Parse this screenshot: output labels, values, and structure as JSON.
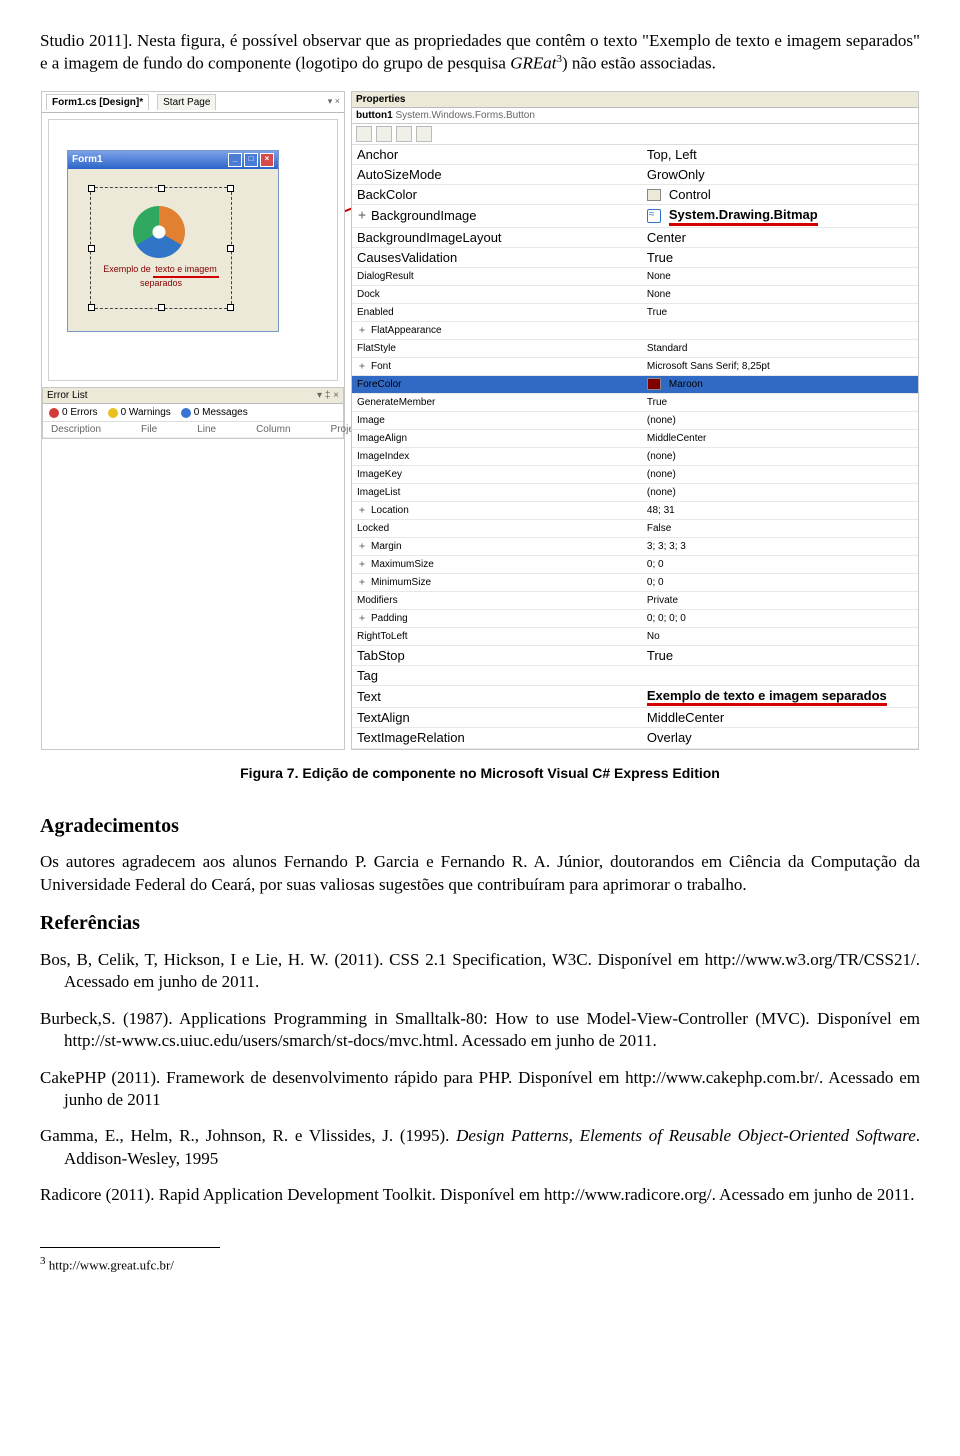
{
  "intro": {
    "lead1": "Studio 2011]. Nesta figura, é possível observar que as propriedades que contêm o texto ",
    "lead2": "\"Exemplo de texto e imagem separados\" e a imagem de fundo do componente (logotipo do grupo de pesquisa ",
    "lead3_italic_prefix": "GREat",
    "lead3_fn": "3",
    "lead_end": ") não estão associadas."
  },
  "figure": {
    "caption": "Figura 7. Edição de componente no Microsoft Visual C# Express Edition",
    "tabs": {
      "active": "Form1.cs [Design]*",
      "other": "Start Page",
      "close": "▾   ×"
    },
    "form_title": "Form1",
    "comp_label_pre": "Exemplo de ",
    "comp_label_hl": "texto e imagem",
    "comp_label_post": " separados",
    "props_header": "Properties",
    "props_object_name": "button1",
    "props_object_class": "System.Windows.Forms.Button",
    "highlight_rows": [
      {
        "k": "Anchor",
        "v": "Top, Left"
      },
      {
        "k": "AutoSizeMode",
        "v": "GrowOnly"
      },
      {
        "k": "BackColor",
        "v": "Control",
        "swatch": "#ece9d8"
      },
      {
        "k": "BackgroundImage",
        "v": "System.Drawing.Bitmap",
        "icon": true,
        "exp": "+",
        "bold": true,
        "underline": true
      },
      {
        "k": "BackgroundImageLayout",
        "v": "Center"
      },
      {
        "k": "CausesValidation",
        "v": "True"
      }
    ],
    "mid_rows": [
      {
        "k": "DialogResult",
        "v": "None"
      },
      {
        "k": "Dock",
        "v": "None"
      },
      {
        "k": "Enabled",
        "v": "True"
      },
      {
        "k": "FlatAppearance",
        "v": "",
        "exp": "+"
      },
      {
        "k": "FlatStyle",
        "v": "Standard"
      },
      {
        "k": "Font",
        "v": "Microsoft Sans Serif; 8,25pt",
        "exp": "+"
      },
      {
        "k": "ForeColor",
        "v": "Maroon",
        "sel": true,
        "swatch": "#800000"
      },
      {
        "k": "GenerateMember",
        "v": "True"
      },
      {
        "k": "Image",
        "v": "(none)"
      },
      {
        "k": "ImageAlign",
        "v": "MiddleCenter"
      },
      {
        "k": "ImageIndex",
        "v": "(none)"
      },
      {
        "k": "ImageKey",
        "v": "(none)"
      },
      {
        "k": "ImageList",
        "v": "(none)"
      },
      {
        "k": "Location",
        "v": "48; 31",
        "exp": "+"
      },
      {
        "k": "Locked",
        "v": "False"
      },
      {
        "k": "Margin",
        "v": "3; 3; 3; 3",
        "exp": "+"
      },
      {
        "k": "MaximumSize",
        "v": "0; 0",
        "exp": "+"
      },
      {
        "k": "MinimumSize",
        "v": "0; 0",
        "exp": "+"
      },
      {
        "k": "Modifiers",
        "v": "Private"
      },
      {
        "k": "Padding",
        "v": "0; 0; 0; 0",
        "exp": "+"
      },
      {
        "k": "RightToLeft",
        "v": "No"
      }
    ],
    "bottom_rows": [
      {
        "k": "TabStop",
        "v": "True"
      },
      {
        "k": "Tag",
        "v": ""
      },
      {
        "k": "Text",
        "v": "Exemplo de texto e imagem separados",
        "bold": true,
        "underline": true
      },
      {
        "k": "TextAlign",
        "v": "MiddleCenter"
      },
      {
        "k": "TextImageRelation",
        "v": "Overlay"
      }
    ],
    "error_list": {
      "title": "Error List",
      "close": "▾ ‡ ×",
      "errors": "0 Errors",
      "warnings": "0 Warnings",
      "messages": "0 Messages",
      "cols": [
        "Description",
        "File",
        "Line",
        "Column",
        "Project"
      ]
    }
  },
  "sections": {
    "ack_title": "Agradecimentos",
    "ack_body": "Os autores agradecem aos alunos Fernando P. Garcia e Fernando R. A. Júnior, doutorandos em Ciência da Computação da Universidade Federal do Ceará, por suas valiosas sugestões que contribuíram para aprimorar o trabalho.",
    "ref_title": "Referências"
  },
  "refs": [
    "Bos, B, Celik, T, Hickson, I e Lie, H. W. (2011). CSS 2.1 Specification, W3C. Disponível em http://www.w3.org/TR/CSS21/. Acessado em junho de 2011.",
    "Burbeck,S. (1987). Applications Programming in Smalltalk-80: How to use Model-View-Controller (MVC). Disponível em http://st-www.cs.uiuc.edu/users/smarch/st-docs/mvc.html. Acessado em junho de 2011.",
    "CakePHP (2011). Framework de desenvolvimento rápido para PHP. Disponível em http://www.cakephp.com.br/. Acessado em junho de 2011",
    "Gamma, E., Helm, R., Johnson, R. e Vlissides, J. (1995). <i>Design Patterns, Elements of Reusable Object-Oriented Software</i>. Addison-Wesley, 1995",
    "Radicore (2011). Rapid Application Development Toolkit. Disponível em http://www.radicore.org/. Acessado em junho de 2011."
  ],
  "footnote": {
    "num": "3",
    "text": " http://www.great.ufc.br/"
  }
}
